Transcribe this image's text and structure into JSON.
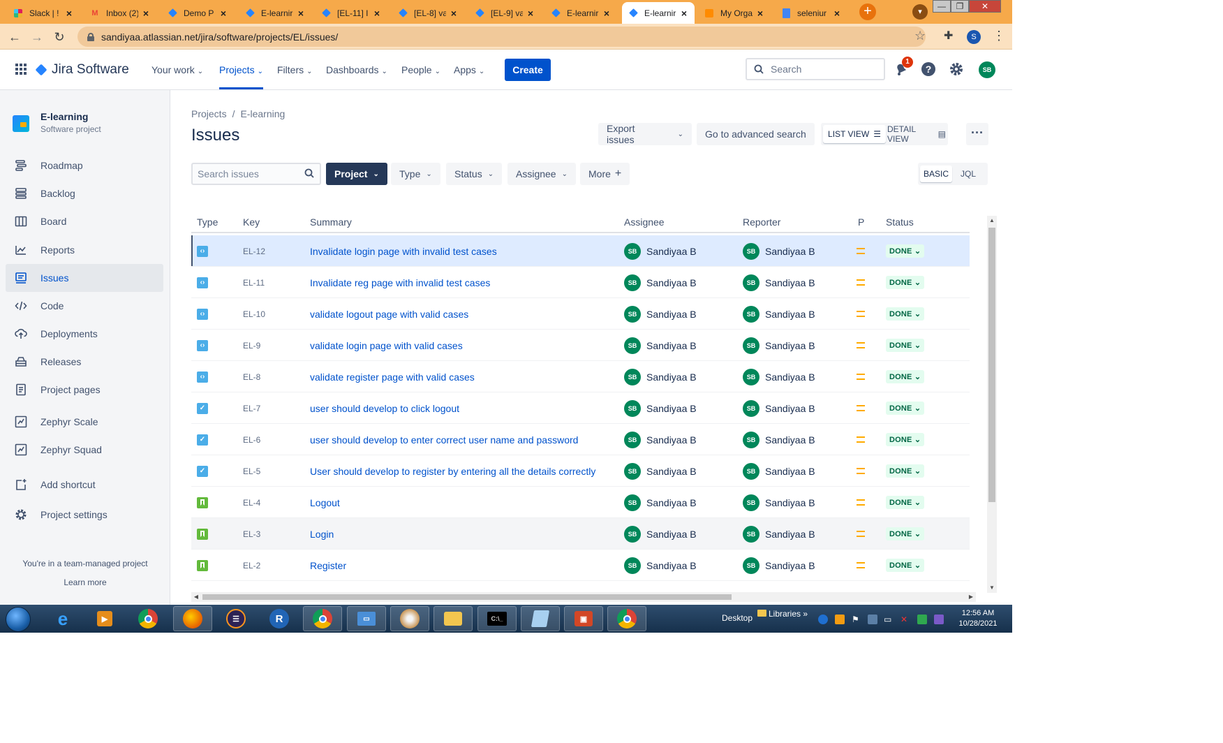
{
  "browser": {
    "tabs": [
      {
        "title": "Slack | !",
        "icon": "slack-icon",
        "color": "#e01e5a",
        "active": false
      },
      {
        "title": "Inbox (2)",
        "icon": "gmail-icon",
        "color": "#ea4335",
        "active": false
      },
      {
        "title": "Demo P",
        "icon": "jira-icon",
        "color": "#2684ff",
        "active": false
      },
      {
        "title": "E-learnir",
        "icon": "jira-icon",
        "color": "#2684ff",
        "active": false
      },
      {
        "title": "[EL-11] I",
        "icon": "jira-icon",
        "color": "#2684ff",
        "active": false
      },
      {
        "title": "[EL-8] va",
        "icon": "jira-icon",
        "color": "#2684ff",
        "active": false
      },
      {
        "title": "[EL-9] va",
        "icon": "jira-icon",
        "color": "#2684ff",
        "active": false
      },
      {
        "title": "E-learnir",
        "icon": "jira-icon",
        "color": "#2684ff",
        "active": false
      },
      {
        "title": "E-learnir",
        "icon": "jira-icon",
        "color": "#2684ff",
        "active": true
      },
      {
        "title": "My Orga",
        "icon": "atlassian-admin-icon",
        "color": "#ff8b00",
        "active": false
      },
      {
        "title": "seleniur",
        "icon": "docs-icon",
        "color": "#4285f4",
        "active": false
      }
    ],
    "new_tab": "+",
    "url": "sandiyaa.atlassian.net/jira/software/projects/EL/issues/",
    "profile_initial": "S"
  },
  "jira": {
    "product": "Jira Software",
    "nav": [
      "Your work",
      "Projects",
      "Filters",
      "Dashboards",
      "People",
      "Apps"
    ],
    "nav_selected": "Projects",
    "create_label": "Create",
    "search_placeholder": "Search",
    "notification_count": "1",
    "user_initials": "SB"
  },
  "sidebar": {
    "project_name": "E-learning",
    "project_type": "Software project",
    "items": [
      {
        "label": "Roadmap",
        "icon": "roadmap-icon"
      },
      {
        "label": "Backlog",
        "icon": "backlog-icon"
      },
      {
        "label": "Board",
        "icon": "board-icon"
      },
      {
        "label": "Reports",
        "icon": "reports-icon"
      },
      {
        "label": "Issues",
        "icon": "issues-icon",
        "selected": true
      },
      {
        "label": "Code",
        "icon": "code-icon"
      },
      {
        "label": "Deployments",
        "icon": "deployments-icon"
      },
      {
        "label": "Releases",
        "icon": "releases-icon"
      },
      {
        "label": "Project pages",
        "icon": "project-pages-icon"
      },
      {
        "label": "Zephyr Scale",
        "icon": "zephyr-scale-icon"
      },
      {
        "label": "Zephyr Squad",
        "icon": "zephyr-squad-icon"
      },
      {
        "label": "Add shortcut",
        "icon": "add-shortcut-icon"
      },
      {
        "label": "Project settings",
        "icon": "gear-icon"
      }
    ],
    "footer_text": "You're in a team-managed project",
    "footer_link": "Learn more"
  },
  "main": {
    "breadcrumb": [
      "Projects",
      "E-learning"
    ],
    "title": "Issues",
    "export_label": "Export issues",
    "advanced_search_label": "Go to advanced search",
    "list_view_label": "LIST VIEW",
    "detail_view_label": "DETAIL VIEW",
    "search_placeholder": "Search issues",
    "filters": [
      "Project",
      "Type",
      "Status",
      "Assignee",
      "More"
    ],
    "basic_label": "BASIC",
    "jql_label": "JQL",
    "columns": [
      "Type",
      "Key",
      "Summary",
      "Assignee",
      "Reporter",
      "P",
      "Status"
    ],
    "rows": [
      {
        "type": "subtask",
        "key": "EL-12",
        "summary": "Invalidate login page with invalid test cases",
        "assignee": "Sandiyaa B",
        "reporter": "Sandiyaa B",
        "status": "DONE"
      },
      {
        "type": "subtask",
        "key": "EL-11",
        "summary": "Invalidate reg page with invalid test cases",
        "assignee": "Sandiyaa B",
        "reporter": "Sandiyaa B",
        "status": "DONE"
      },
      {
        "type": "subtask",
        "key": "EL-10",
        "summary": "validate logout page with valid cases",
        "assignee": "Sandiyaa B",
        "reporter": "Sandiyaa B",
        "status": "DONE"
      },
      {
        "type": "subtask",
        "key": "EL-9",
        "summary": "validate login page with valid cases",
        "assignee": "Sandiyaa B",
        "reporter": "Sandiyaa B",
        "status": "DONE"
      },
      {
        "type": "subtask",
        "key": "EL-8",
        "summary": "validate register page with valid cases",
        "assignee": "Sandiyaa B",
        "reporter": "Sandiyaa B",
        "status": "DONE"
      },
      {
        "type": "task",
        "key": "EL-7",
        "summary": "user should develop to click logout",
        "assignee": "Sandiyaa B",
        "reporter": "Sandiyaa B",
        "status": "DONE"
      },
      {
        "type": "task",
        "key": "EL-6",
        "summary": "user should develop to enter correct user name and password",
        "assignee": "Sandiyaa B",
        "reporter": "Sandiyaa B",
        "status": "DONE"
      },
      {
        "type": "task",
        "key": "EL-5",
        "summary": "User should develop to register by entering all the details correctly",
        "assignee": "Sandiyaa B",
        "reporter": "Sandiyaa B",
        "status": "DONE"
      },
      {
        "type": "story",
        "key": "EL-4",
        "summary": "Logout",
        "assignee": "Sandiyaa B",
        "reporter": "Sandiyaa B",
        "status": "DONE"
      },
      {
        "type": "story",
        "key": "EL-3",
        "summary": "Login",
        "assignee": "Sandiyaa B",
        "reporter": "Sandiyaa B",
        "status": "DONE"
      },
      {
        "type": "story",
        "key": "EL-2",
        "summary": "Register",
        "assignee": "Sandiyaa B",
        "reporter": "Sandiyaa B",
        "status": "DONE"
      }
    ],
    "avatar_initials": "SB"
  },
  "taskbar": {
    "desktop_label": "Desktop",
    "libraries_label": "Libraries",
    "time": "12:56 AM",
    "date": "10/28/2021"
  }
}
